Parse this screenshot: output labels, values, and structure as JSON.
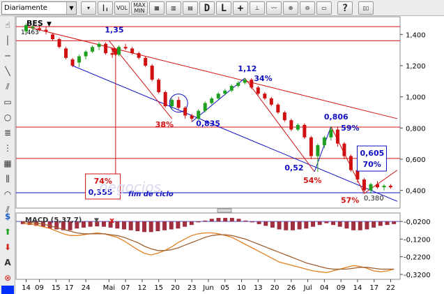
{
  "toolbar": {
    "period_select": "Diariamente",
    "vol_label": "VOL",
    "maxmin_label": "MAX MIN",
    "d_label": "D",
    "l_label": "L",
    "icons": [
      "chart-type-icon",
      "bar-icon",
      "candle-icon",
      "grid-icon",
      "log-icon",
      "cursor-icon",
      "crosshair-icon",
      "zoom-in-icon",
      "zoom-out-icon",
      "print-icon",
      "help-icon",
      "book-icon"
    ]
  },
  "left_tools": [
    "hand-icon",
    "line-icon",
    "hline-icon",
    "diag-line-icon",
    "channel-icon",
    "rect-icon",
    "circle-icon",
    "fib-icon",
    "fib-fan-icon",
    "grid-tool-icon",
    "gann-icon",
    "arc-icon",
    "parallel-icon",
    "dollar-icon",
    "up-arrow-icon",
    "down-arrow-icon",
    "text-icon",
    "delete-icon",
    "color-icon"
  ],
  "chart_data": {
    "type": "candlestick",
    "title": "BES",
    "last_value_label": "1,463",
    "y_ticks": [
      "1,400",
      "1,200",
      "1,000",
      "0,800",
      "0,600",
      "0,400"
    ],
    "ylim": [
      0.3,
      1.5
    ],
    "x_ticks": [
      "14",
      "09",
      "15",
      "17",
      "24",
      "Mai",
      "07",
      "12",
      "15",
      "20",
      "23",
      "Jun",
      "05",
      "10",
      "13",
      "20",
      "26",
      "Jul",
      "04",
      "09",
      "14",
      "17",
      "22"
    ],
    "x_ticks_positions_in_days": [
      0,
      4,
      9,
      13,
      18,
      25,
      30,
      35,
      40,
      45,
      50,
      55,
      60,
      65,
      70,
      75,
      80,
      85,
      90,
      95,
      100,
      105,
      110
    ],
    "horizontal_levels": [
      1.45,
      1.36,
      0.806,
      0.605,
      0.385
    ],
    "candles": [
      {
        "x": 0,
        "o": 1.42,
        "h": 1.47,
        "l": 1.4,
        "c": 1.46
      },
      {
        "x": 2,
        "o": 1.44,
        "h": 1.46,
        "l": 1.43,
        "c": 1.45
      },
      {
        "x": 4,
        "o": 1.44,
        "h": 1.46,
        "l": 1.42,
        "c": 1.43
      },
      {
        "x": 6,
        "o": 1.43,
        "h": 1.45,
        "l": 1.4,
        "c": 1.42
      },
      {
        "x": 8,
        "o": 1.4,
        "h": 1.41,
        "l": 1.36,
        "c": 1.37
      },
      {
        "x": 10,
        "o": 1.37,
        "h": 1.38,
        "l": 1.31,
        "c": 1.32
      },
      {
        "x": 12,
        "o": 1.31,
        "h": 1.32,
        "l": 1.24,
        "c": 1.25
      },
      {
        "x": 14,
        "o": 1.24,
        "h": 1.25,
        "l": 1.19,
        "c": 1.2
      },
      {
        "x": 16,
        "o": 1.22,
        "h": 1.27,
        "l": 1.19,
        "c": 1.26
      },
      {
        "x": 18,
        "o": 1.26,
        "h": 1.3,
        "l": 1.24,
        "c": 1.29
      },
      {
        "x": 20,
        "o": 1.29,
        "h": 1.33,
        "l": 1.28,
        "c": 1.32
      },
      {
        "x": 22,
        "o": 1.32,
        "h": 1.35,
        "l": 1.3,
        "c": 1.34
      },
      {
        "x": 24,
        "o": 1.34,
        "h": 1.35,
        "l": 1.27,
        "c": 1.28
      },
      {
        "x": 26,
        "o": 1.28,
        "h": 1.3,
        "l": 1.25,
        "c": 1.27
      },
      {
        "x": 28,
        "o": 1.27,
        "h": 1.33,
        "l": 1.26,
        "c": 1.32
      },
      {
        "x": 30,
        "o": 1.32,
        "h": 1.34,
        "l": 1.3,
        "c": 1.31
      },
      {
        "x": 32,
        "o": 1.31,
        "h": 1.32,
        "l": 1.27,
        "c": 1.28
      },
      {
        "x": 34,
        "o": 1.28,
        "h": 1.29,
        "l": 1.24,
        "c": 1.25
      },
      {
        "x": 36,
        "o": 1.25,
        "h": 1.26,
        "l": 1.19,
        "c": 1.2
      },
      {
        "x": 38,
        "o": 1.2,
        "h": 1.21,
        "l": 1.1,
        "c": 1.11
      },
      {
        "x": 40,
        "o": 1.11,
        "h": 1.12,
        "l": 1.02,
        "c": 1.03
      },
      {
        "x": 42,
        "o": 1.03,
        "h": 1.04,
        "l": 0.93,
        "c": 0.94
      },
      {
        "x": 44,
        "o": 0.94,
        "h": 0.99,
        "l": 0.92,
        "c": 0.98
      },
      {
        "x": 46,
        "o": 0.98,
        "h": 1.0,
        "l": 0.92,
        "c": 0.93
      },
      {
        "x": 48,
        "o": 0.93,
        "h": 0.94,
        "l": 0.86,
        "c": 0.88
      },
      {
        "x": 50,
        "o": 0.88,
        "h": 0.89,
        "l": 0.84,
        "c": 0.86
      },
      {
        "x": 52,
        "o": 0.86,
        "h": 0.92,
        "l": 0.85,
        "c": 0.91
      },
      {
        "x": 54,
        "o": 0.91,
        "h": 0.97,
        "l": 0.9,
        "c": 0.96
      },
      {
        "x": 56,
        "o": 0.96,
        "h": 1.0,
        "l": 0.95,
        "c": 0.99
      },
      {
        "x": 58,
        "o": 0.99,
        "h": 1.03,
        "l": 0.98,
        "c": 1.02
      },
      {
        "x": 60,
        "o": 1.02,
        "h": 1.05,
        "l": 1.01,
        "c": 1.04
      },
      {
        "x": 62,
        "o": 1.04,
        "h": 1.08,
        "l": 1.03,
        "c": 1.07
      },
      {
        "x": 64,
        "o": 1.07,
        "h": 1.1,
        "l": 1.06,
        "c": 1.09
      },
      {
        "x": 66,
        "o": 1.09,
        "h": 1.12,
        "l": 1.08,
        "c": 1.11
      },
      {
        "x": 68,
        "o": 1.11,
        "h": 1.12,
        "l": 1.05,
        "c": 1.06
      },
      {
        "x": 70,
        "o": 1.06,
        "h": 1.07,
        "l": 1.01,
        "c": 1.02
      },
      {
        "x": 72,
        "o": 1.02,
        "h": 1.03,
        "l": 0.98,
        "c": 0.99
      },
      {
        "x": 74,
        "o": 0.99,
        "h": 1.0,
        "l": 0.94,
        "c": 0.95
      },
      {
        "x": 76,
        "o": 0.95,
        "h": 0.96,
        "l": 0.89,
        "c": 0.9
      },
      {
        "x": 78,
        "o": 0.9,
        "h": 0.91,
        "l": 0.84,
        "c": 0.85
      },
      {
        "x": 80,
        "o": 0.85,
        "h": 0.86,
        "l": 0.78,
        "c": 0.79
      },
      {
        "x": 82,
        "o": 0.79,
        "h": 0.83,
        "l": 0.78,
        "c": 0.82
      },
      {
        "x": 84,
        "o": 0.82,
        "h": 0.83,
        "l": 0.73,
        "c": 0.74
      },
      {
        "x": 86,
        "o": 0.74,
        "h": 0.75,
        "l": 0.6,
        "c": 0.62
      },
      {
        "x": 88,
        "o": 0.62,
        "h": 0.7,
        "l": 0.52,
        "c": 0.69
      },
      {
        "x": 90,
        "o": 0.69,
        "h": 0.75,
        "l": 0.67,
        "c": 0.74
      },
      {
        "x": 92,
        "o": 0.74,
        "h": 0.81,
        "l": 0.72,
        "c": 0.79
      },
      {
        "x": 94,
        "o": 0.79,
        "h": 0.81,
        "l": 0.68,
        "c": 0.7
      },
      {
        "x": 96,
        "o": 0.7,
        "h": 0.71,
        "l": 0.6,
        "c": 0.62
      },
      {
        "x": 98,
        "o": 0.62,
        "h": 0.63,
        "l": 0.52,
        "c": 0.53
      },
      {
        "x": 100,
        "o": 0.53,
        "h": 0.54,
        "l": 0.45,
        "c": 0.47
      },
      {
        "x": 102,
        "o": 0.47,
        "h": 0.48,
        "l": 0.39,
        "c": 0.4
      },
      {
        "x": 104,
        "o": 0.4,
        "h": 0.45,
        "l": 0.38,
        "c": 0.44
      },
      {
        "x": 106,
        "o": 0.44,
        "h": 0.46,
        "l": 0.41,
        "c": 0.42
      },
      {
        "x": 108,
        "o": 0.42,
        "h": 0.44,
        "l": 0.4,
        "c": 0.43
      },
      {
        "x": 110,
        "o": 0.43,
        "h": 0.44,
        "l": 0.41,
        "c": 0.42
      }
    ],
    "annotations": [
      {
        "text": "1,35",
        "x": 25,
        "y": 1.36,
        "color": "#1010c0",
        "dx": -6,
        "dy": -12
      },
      {
        "text": "38%",
        "x": 44,
        "y": 0.86,
        "color": "#d01010",
        "dx": -24,
        "dy": 12
      },
      {
        "text": "0,835",
        "x": 50,
        "y": 0.84,
        "color": "#1010c0",
        "dx": 6,
        "dy": 6
      },
      {
        "text": "1,12",
        "x": 66,
        "y": 1.12,
        "color": "#1010c0",
        "dx": -10,
        "dy": -10
      },
      {
        "text": "34%",
        "x": 70,
        "y": 1.12,
        "color": "#1010c0",
        "dx": -6,
        "dy": 4
      },
      {
        "text": "0,806",
        "x": 92,
        "y": 0.81,
        "color": "#1010c0",
        "dx": -10,
        "dy": -10
      },
      {
        "text": "59%",
        "x": 95,
        "y": 0.81,
        "color": "#1010c0",
        "dx": 0,
        "dy": 6
      },
      {
        "text": "0,52",
        "x": 86,
        "y": 0.52,
        "color": "#1010c0",
        "dx": -38,
        "dy": -2
      },
      {
        "text": "54%",
        "x": 87,
        "y": 0.52,
        "color": "#d01010",
        "dx": -16,
        "dy": 16
      },
      {
        "text": "57%",
        "x": 100,
        "y": 0.4,
        "color": "#d01010",
        "dx": -24,
        "dy": 18
      }
    ],
    "boxes": [
      {
        "lines": [
          "74%",
          "0,355"
        ],
        "colors": [
          "#d01010",
          "#1010c0"
        ],
        "x": 20,
        "y": 0.355
      },
      {
        "lines": [
          "0,605",
          "70%"
        ],
        "colors": [
          "#1010c0",
          "#1010c0"
        ],
        "x": 102,
        "y": 0.605
      }
    ],
    "bottom_low_label": "0,380",
    "fim_label": "fim de ciclo",
    "watermark": "negocios",
    "macd": {
      "title": "MACD (5,37,7)",
      "close_mark": "x",
      "ticks": [
        "-0,0200",
        "-0,1200",
        "-0,2200",
        "-0,3200"
      ],
      "ylim": [
        -0.34,
        0.02
      ],
      "hist": [
        -0.015,
        -0.02,
        -0.025,
        -0.03,
        -0.04,
        -0.045,
        -0.05,
        -0.05,
        -0.04,
        -0.035,
        -0.03,
        -0.028,
        -0.03,
        -0.035,
        -0.04,
        -0.045,
        -0.05,
        -0.055,
        -0.06,
        -0.06,
        -0.055,
        -0.05,
        -0.045,
        -0.04,
        -0.03,
        -0.02,
        -0.005,
        0.005,
        0.015,
        0.02,
        0.02,
        0.02,
        0.015,
        0.005,
        -0.005,
        -0.015,
        -0.025,
        -0.035,
        -0.045,
        -0.05,
        -0.05,
        -0.045,
        -0.04,
        -0.03,
        -0.02,
        -0.01,
        -0.02,
        -0.03,
        -0.04,
        -0.05,
        -0.05,
        -0.045,
        -0.035,
        -0.025,
        -0.02,
        -0.015
      ],
      "macd_line": [
        -0.03,
        -0.035,
        -0.04,
        -0.05,
        -0.06,
        -0.075,
        -0.09,
        -0.1,
        -0.1,
        -0.095,
        -0.09,
        -0.085,
        -0.09,
        -0.1,
        -0.11,
        -0.13,
        -0.155,
        -0.18,
        -0.2,
        -0.21,
        -0.2,
        -0.185,
        -0.165,
        -0.14,
        -0.12,
        -0.1,
        -0.09,
        -0.085,
        -0.085,
        -0.09,
        -0.1,
        -0.11,
        -0.13,
        -0.15,
        -0.17,
        -0.19,
        -0.21,
        -0.23,
        -0.25,
        -0.26,
        -0.27,
        -0.28,
        -0.29,
        -0.3,
        -0.305,
        -0.31,
        -0.3,
        -0.29,
        -0.28,
        -0.27,
        -0.275,
        -0.285,
        -0.3,
        -0.305,
        -0.3,
        -0.29
      ],
      "signal_line": [
        -0.02,
        -0.025,
        -0.03,
        -0.035,
        -0.045,
        -0.055,
        -0.065,
        -0.075,
        -0.085,
        -0.09,
        -0.09,
        -0.09,
        -0.09,
        -0.095,
        -0.1,
        -0.11,
        -0.125,
        -0.14,
        -0.16,
        -0.175,
        -0.185,
        -0.185,
        -0.18,
        -0.17,
        -0.155,
        -0.14,
        -0.125,
        -0.11,
        -0.1,
        -0.095,
        -0.095,
        -0.1,
        -0.11,
        -0.12,
        -0.135,
        -0.15,
        -0.165,
        -0.18,
        -0.195,
        -0.21,
        -0.225,
        -0.24,
        -0.255,
        -0.265,
        -0.275,
        -0.285,
        -0.29,
        -0.29,
        -0.29,
        -0.285,
        -0.28,
        -0.28,
        -0.285,
        -0.29,
        -0.29,
        -0.29
      ]
    }
  }
}
